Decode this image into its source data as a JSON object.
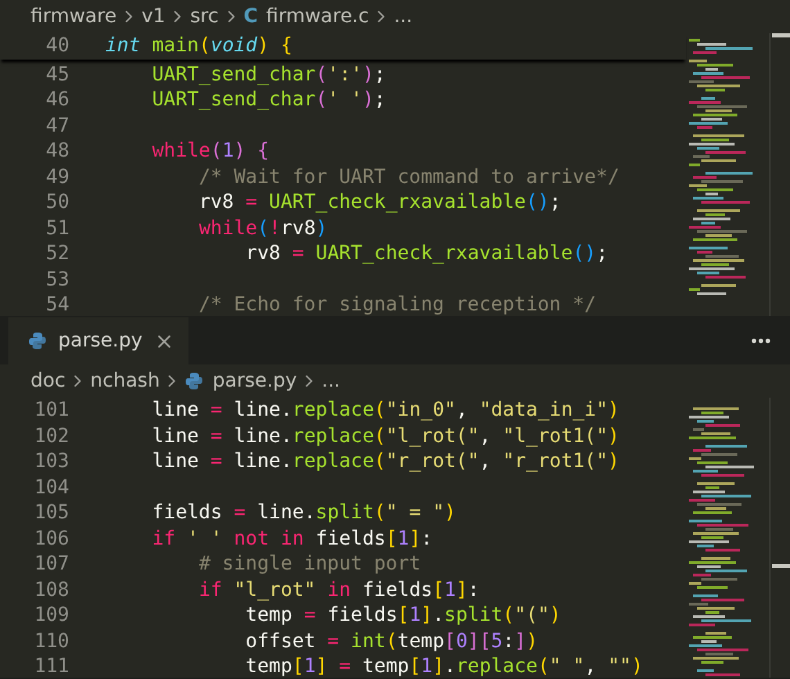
{
  "panes": [
    {
      "breadcrumbs": [
        {
          "kind": "folder",
          "label": "firmware"
        },
        {
          "kind": "folder",
          "label": "v1"
        },
        {
          "kind": "folder",
          "label": "src"
        },
        {
          "kind": "file",
          "icon_text": "C",
          "label": "firmware.c"
        },
        {
          "kind": "more",
          "label": "..."
        }
      ],
      "sticky_line": {
        "number": "40",
        "code": "int main(void) {"
      },
      "lines": [
        {
          "number": "45",
          "code": "    UART_send_char(':');"
        },
        {
          "number": "46",
          "code": "    UART_send_char(' ');"
        },
        {
          "number": "47"
        },
        {
          "number": "48",
          "code": "    while(1) {"
        },
        {
          "number": "49",
          "code": "        /* Wait for UART command to arrive*/"
        },
        {
          "number": "50",
          "code": "        rv8 = UART_check_rxavailable();"
        },
        {
          "number": "51",
          "code": "        while(!rv8)"
        },
        {
          "number": "52",
          "code": "            rv8 = UART_check_rxavailable();"
        },
        {
          "number": "53"
        },
        {
          "number": "54",
          "code": "        /* Echo for signaling reception */"
        }
      ]
    },
    {
      "tab": {
        "label": "parse.py",
        "selected": true
      },
      "breadcrumbs": [
        {
          "kind": "folder",
          "label": "doc"
        },
        {
          "kind": "folder",
          "label": "nchash"
        },
        {
          "kind": "file",
          "label": "parse.py"
        },
        {
          "kind": "more",
          "label": "..."
        }
      ],
      "lines": [
        {
          "number": "101",
          "code": "    line = line.replace(\"in_0\", \"data_in_i\")"
        },
        {
          "number": "102",
          "code": "    line = line.replace(\"l_rot(\", \"l_rot1(\")"
        },
        {
          "number": "103",
          "code": "    line = line.replace(\"r_rot(\", \"r_rot1(\")"
        },
        {
          "number": "104"
        },
        {
          "number": "105",
          "code": "    fields = line.split(\" = \")"
        },
        {
          "number": "106",
          "code": "    if ' ' not in fields[1]:"
        },
        {
          "number": "107",
          "code": "        # single input port"
        },
        {
          "number": "108",
          "code": "        if \"l_rot\" in fields[1]:"
        },
        {
          "number": "109",
          "code": "            temp = fields[1].split(\"(\")"
        },
        {
          "number": "110",
          "code": "            offset = int(temp[0][5:])"
        },
        {
          "number": "111",
          "code": "            temp[1] = temp[1].replace(\" \", \"\")"
        }
      ]
    }
  ]
}
